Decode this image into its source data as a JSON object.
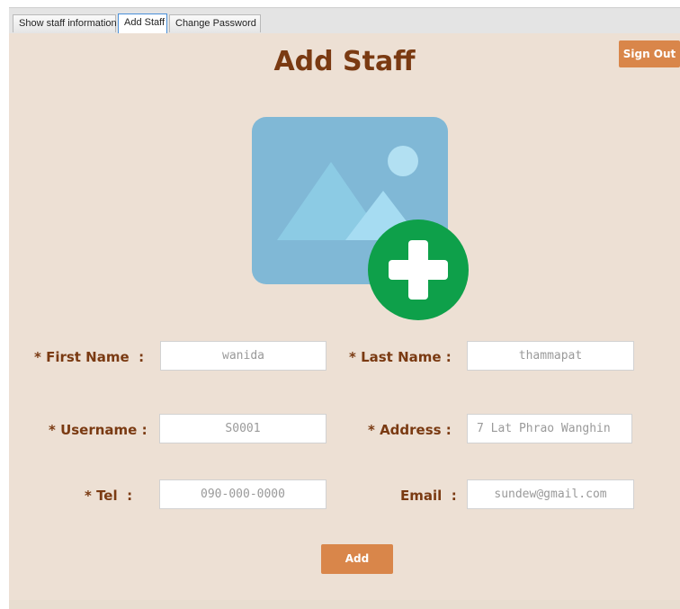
{
  "tabs": [
    {
      "label": "Show staff information",
      "active": false
    },
    {
      "label": "Add Staff",
      "active": true
    },
    {
      "label": "Change Password",
      "active": false
    }
  ],
  "header": {
    "title": "Add Staff",
    "sign_out_label": "Sign Out"
  },
  "photo": {
    "icon": "add-image-icon"
  },
  "form": {
    "first_name": {
      "label": "* First Name  :",
      "value": "wanida"
    },
    "last_name": {
      "label": "* Last Name :",
      "value": "thammapat"
    },
    "username": {
      "label": "* Username :",
      "value": "S0001"
    },
    "address": {
      "label": "* Address :",
      "value": "7 Lat Phrao Wanghin"
    },
    "tel": {
      "label": "* Tel  :",
      "value": "090-000-0000"
    },
    "email": {
      "label": "Email  :",
      "value": "sundew@gmail.com"
    },
    "add_label": "Add"
  },
  "colors": {
    "background": "#ede0d4",
    "title": "#7a3a12",
    "button": "#d9864a",
    "photo_frame": "#80b8d6",
    "plus_badge": "#0ea04a"
  }
}
